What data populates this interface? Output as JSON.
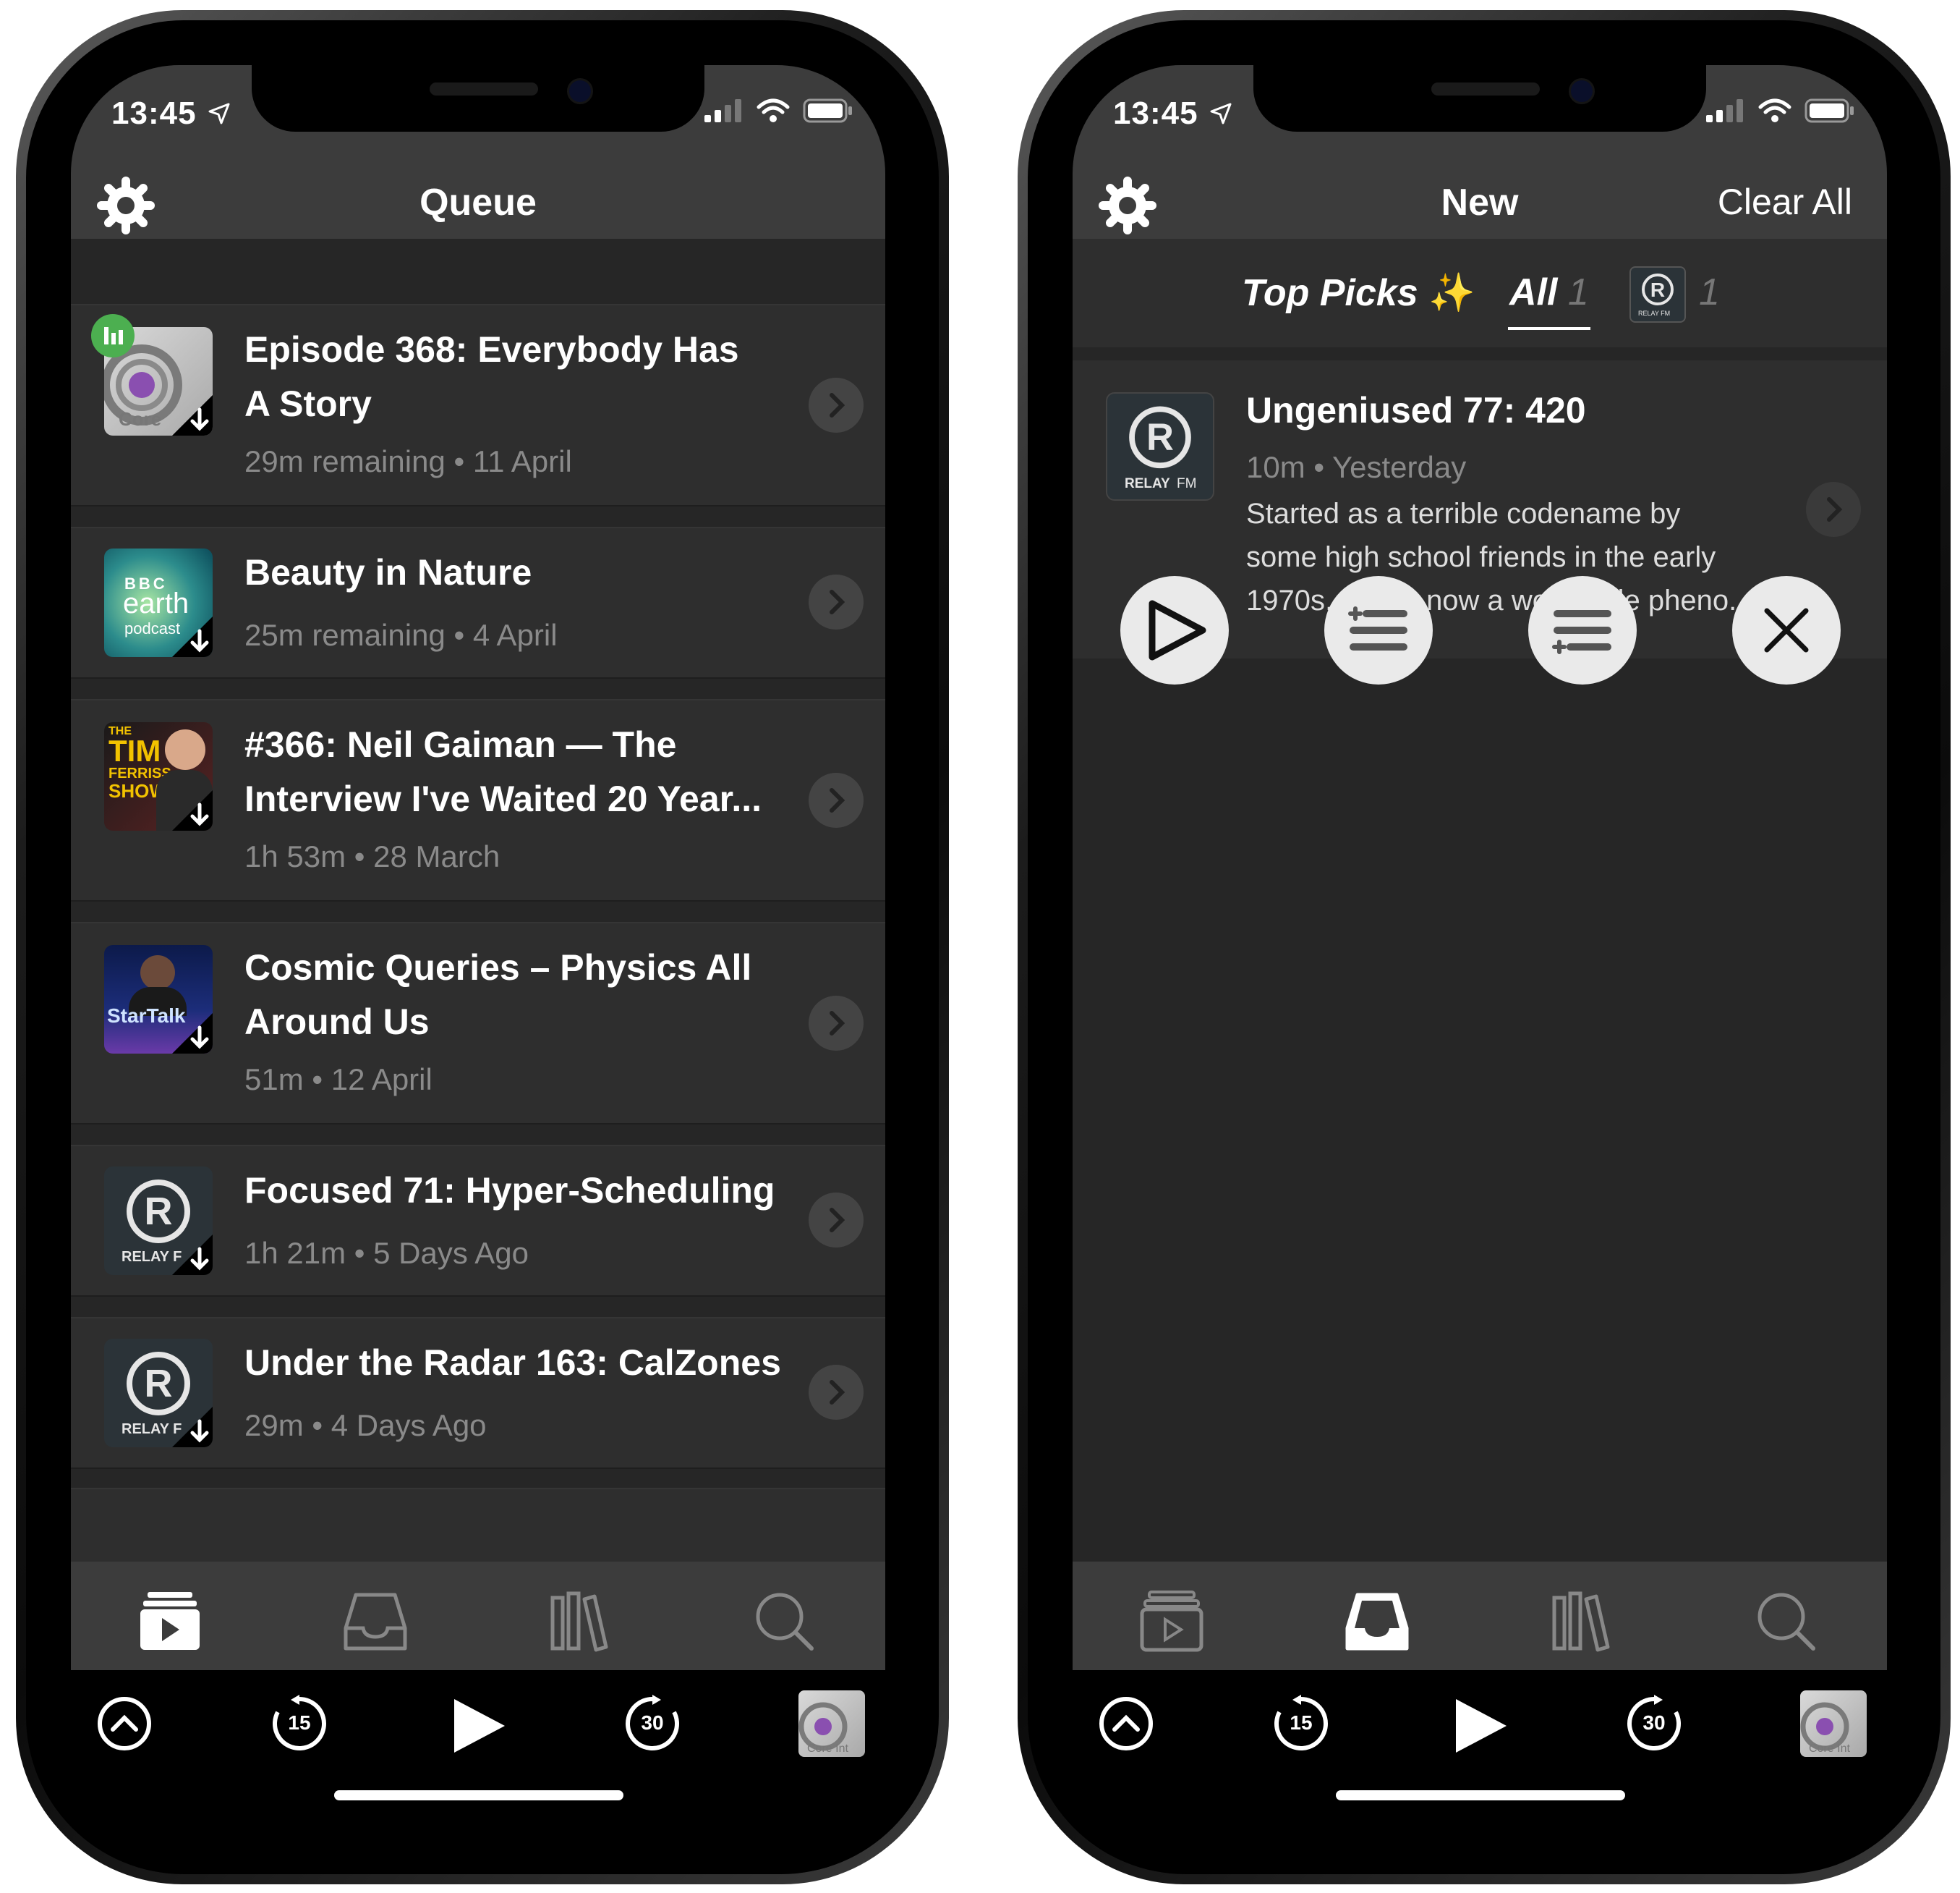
{
  "left_screen": {
    "status": {
      "time": "13:45"
    },
    "header": {
      "title": "Queue"
    },
    "episodes": [
      {
        "title_line1": "Episode 368: Everybody Has",
        "title_line2": "A Story",
        "meta": "29m remaining • 11 April",
        "art_label": "Core"
      },
      {
        "title_line1": "Beauty in Nature",
        "meta": "25m remaining • 4 April",
        "art_label_1": "BBC",
        "art_label_2": "earth",
        "art_label_3": "podcast"
      },
      {
        "title_line1": "#366: Neil Gaiman — The",
        "title_line2": "Interview I've Waited 20 Year...",
        "meta": "1h 53m • 28 March",
        "art_label_1": "THE",
        "art_label_2": "TIM",
        "art_label_3": "FERRISS",
        "art_label_4": "SHOW"
      },
      {
        "title_line1": "Cosmic Queries – Physics All",
        "title_line2": "Around Us",
        "meta": "51m • 12 April",
        "art_label": "StarTalk"
      },
      {
        "title_line1": "Focused 71: Hyper-Scheduling",
        "meta": "1h 21m • 5 Days Ago",
        "art_label": "RELAY F"
      },
      {
        "title_line1": "Under the Radar 163: CalZones",
        "meta": "29m • 4 Days Ago",
        "art_label": "RELAY F"
      }
    ],
    "player": {
      "skip_back": "15",
      "skip_forward": "30",
      "now_playing_label": "Core Int"
    }
  },
  "right_screen": {
    "status": {
      "time": "13:45"
    },
    "header": {
      "title": "New",
      "clear_all": "Clear All"
    },
    "segments": {
      "top_picks": "Top Picks",
      "sparkle": "✨",
      "all": "All",
      "all_count": "1",
      "relay_count": "1",
      "relay_label": "RELAY FM"
    },
    "episode": {
      "title": "Ungeniused 77: 420",
      "meta": "10m • Yesterday",
      "desc_line1": "Started as a terrible codename by",
      "desc_line2": "some high school friends in the early",
      "desc_line3": "1970s, 420 is now a worldwide pheno...",
      "art_label_1": "RELAY",
      "art_label_2": "FM"
    },
    "player": {
      "skip_back": "15",
      "skip_forward": "30",
      "now_playing_label": "Core Int"
    }
  },
  "colors": {
    "background": "#262626",
    "bar": "#3c3c3c",
    "row": "#2e2e2e",
    "muted_text": "#8a8a8a",
    "accent_green": "#4caf50"
  }
}
